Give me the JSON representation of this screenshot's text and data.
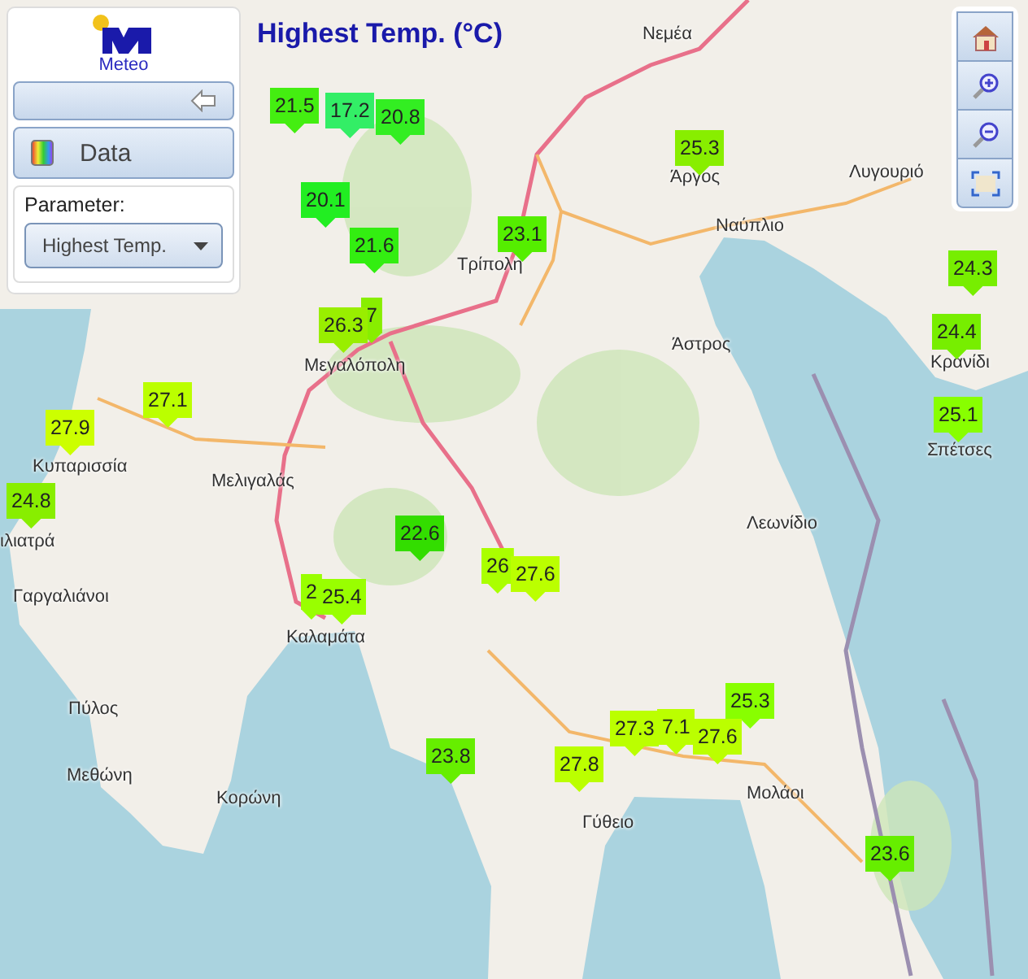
{
  "title": "Highest Temp. (°C)",
  "panel": {
    "logo_text": "Meteo",
    "data_button": "Data",
    "parameter_label": "Parameter:",
    "parameter_select": "Highest Temp."
  },
  "markers": [
    {
      "value": "21.5",
      "color": "#44ee11"
    },
    {
      "value": "17.2",
      "color": "#33ee66"
    },
    {
      "value": "20.8",
      "color": "#33ee22"
    },
    {
      "value": "25.3",
      "color": "#88ee00"
    },
    {
      "value": "20.1",
      "color": "#22ee22"
    },
    {
      "value": "23.1",
      "color": "#55ee00"
    },
    {
      "value": "21.6",
      "color": "#33ee11"
    },
    {
      "value": "24.3",
      "color": "#77ee00"
    },
    {
      "value": "7",
      "color": "#88ee00"
    },
    {
      "value": "26.3",
      "color": "#99ee00"
    },
    {
      "value": "24.4",
      "color": "#77ee00"
    },
    {
      "value": "27.1",
      "color": "#bbff00"
    },
    {
      "value": "25.1",
      "color": "#88ff00"
    },
    {
      "value": "27.9",
      "color": "#ccff00"
    },
    {
      "value": "24.8",
      "color": "#88ee00"
    },
    {
      "value": "22.6",
      "color": "#33dd00"
    },
    {
      "value": "26",
      "color": "#aaff00"
    },
    {
      "value": "27.6",
      "color": "#bbff00"
    },
    {
      "value": "2",
      "color": "#99ff00"
    },
    {
      "value": "25.4",
      "color": "#99ff00"
    },
    {
      "value": "25.3",
      "color": "#88ff00"
    },
    {
      "value": "27.3",
      "color": "#bbff00"
    },
    {
      "value": "7.1",
      "color": "#bbff00"
    },
    {
      "value": "27.6",
      "color": "#bbff00"
    },
    {
      "value": "23.8",
      "color": "#66ee00"
    },
    {
      "value": "27.8",
      "color": "#bbff00"
    },
    {
      "value": "23.6",
      "color": "#66ee00"
    }
  ],
  "places": [
    "Νεμέα",
    "Άργος",
    "Ναύπλιο",
    "Λυγουριό",
    "Τρίπολη",
    "Άστρος",
    "Κρανίδι",
    "Σπέτσες",
    "Μεγαλόπολη",
    "Κυπαρισσία",
    "Μελιγαλάς",
    "ιλιατρά",
    "Λεωνίδιο",
    "Γαργαλιάνοι",
    "Καλαμάτα",
    "Πύλος",
    "Μεθώνη",
    "Κορώνη",
    "Γύθειο",
    "Μολάοι"
  ]
}
